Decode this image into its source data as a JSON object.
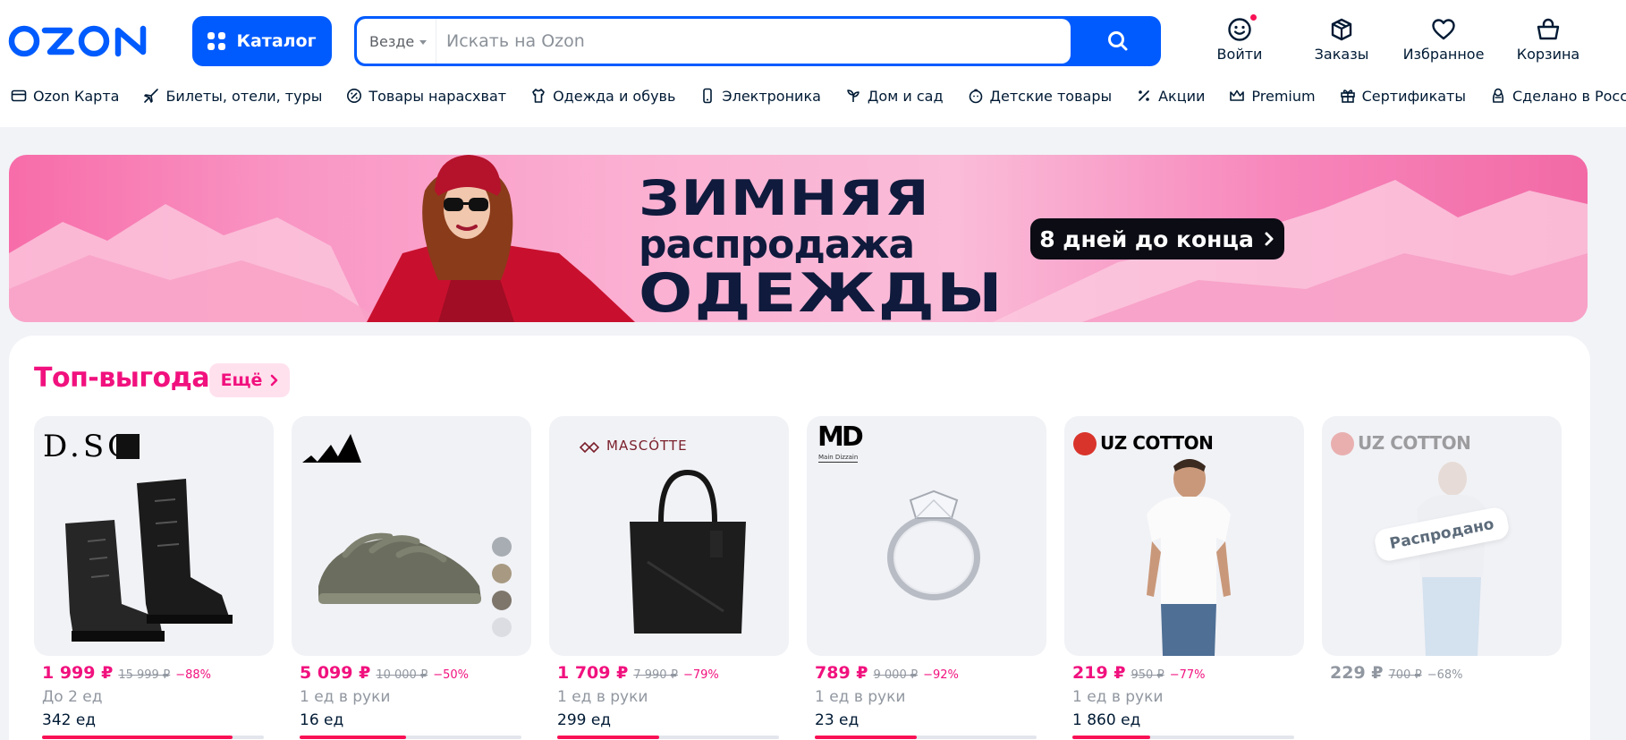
{
  "header": {
    "logo_text": "OZON",
    "catalog_label": "Каталог",
    "search": {
      "scope": "Везде",
      "placeholder": "Искать на Ozon"
    },
    "actions": [
      {
        "label": "Войти",
        "icon": "user-smile-icon"
      },
      {
        "label": "Заказы",
        "icon": "box-icon"
      },
      {
        "label": "Избранное",
        "icon": "heart-icon"
      },
      {
        "label": "Корзина",
        "icon": "cart-icon"
      }
    ]
  },
  "nav": [
    {
      "label": "Ozon Карта",
      "icon": "card-icon"
    },
    {
      "label": "Билеты, отели, туры",
      "icon": "plane-icon"
    },
    {
      "label": "Товары нарасхват",
      "icon": "percent-circle-icon"
    },
    {
      "label": "Одежда и обувь",
      "icon": "clothes-icon"
    },
    {
      "label": "Электроника",
      "icon": "phone-icon"
    },
    {
      "label": "Дом и сад",
      "icon": "plant-icon"
    },
    {
      "label": "Детские товары",
      "icon": "child-icon"
    },
    {
      "label": "Акции",
      "icon": "percent-icon"
    },
    {
      "label": "Premium",
      "icon": "crown-icon"
    },
    {
      "label": "Сертификаты",
      "icon": "gift-icon"
    },
    {
      "label": "Сделано в России",
      "icon": "matryoshka-icon"
    }
  ],
  "banner": {
    "line1": "ЗИМНЯЯ",
    "line2": "распродажа",
    "line3": "ОДЕЖДЫ",
    "pill": "8 дней до конца"
  },
  "section": {
    "title": "Топ-выгода",
    "more_label": "Ещё"
  },
  "products": [
    {
      "brand": "D.SO",
      "price": "1 999 ₽",
      "old_price": "15 999 ₽",
      "discount": "−88%",
      "limit": "До 2 ед",
      "stock": "342 ед",
      "stock_progress": 0.86
    },
    {
      "brand": "adidas",
      "price": "5 099 ₽",
      "old_price": "10 000 ₽",
      "discount": "−50%",
      "limit": "1 ед в руки",
      "stock": "16 ед",
      "stock_progress": 0.48
    },
    {
      "brand": "MASCÓTTE",
      "price": "1 709 ₽",
      "old_price": "7 990 ₽",
      "discount": "−79%",
      "limit": "1 ед в руки",
      "stock": "299 ед",
      "stock_progress": 0.46
    },
    {
      "brand": "MD",
      "brand_sub": "Main Dizzain",
      "price": "789 ₽",
      "old_price": "9 000 ₽",
      "discount": "−92%",
      "limit": "1 ед в руки",
      "stock": "23 ед",
      "stock_progress": 0.46
    },
    {
      "brand": "UZ COTTON",
      "price": "219 ₽",
      "old_price": "950 ₽",
      "discount": "−77%",
      "limit": "1 ед в руки",
      "stock": "1 860 ед",
      "stock_progress": 0.35
    },
    {
      "brand": "UZ COTTON",
      "price": "229 ₽",
      "old_price": "700 ₽",
      "discount": "−68%",
      "soldout_label": "Распродано"
    }
  ],
  "colors": {
    "brand_blue": "#005bff",
    "accent_pink": "#f1117e",
    "badge_red": "#f91155"
  }
}
